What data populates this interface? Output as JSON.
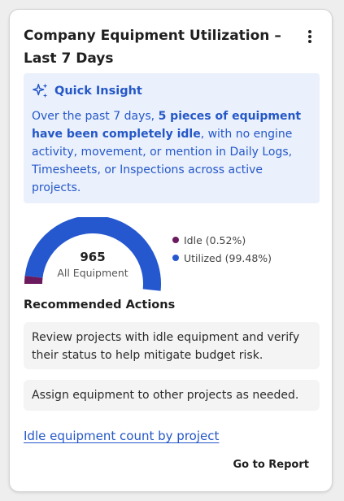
{
  "card": {
    "title": "Company Equipment Utilization – Last 7 Days",
    "menu_icon": "more-vertical-icon"
  },
  "insight": {
    "icon": "sparkles-icon",
    "title": "Quick Insight",
    "text_before": "Over the past 7 days, ",
    "text_bold": "5 pieces of equipment have been completely idle",
    "text_after": ", with no engine activity, movement, or mention in Daily Logs, Timesheets, or Inspections across active projects.",
    "accent_color": "#2557c7",
    "background_color": "#eaf1fd"
  },
  "chart_data": {
    "type": "pie",
    "variant": "semicircle-gauge",
    "total_value": "965",
    "total_label": "All Equipment",
    "series": [
      {
        "name": "Idle (0.52%)",
        "value": 0.52,
        "color": "#6b1a5e"
      },
      {
        "name": "Utilized (99.48%)",
        "value": 99.48,
        "color": "#2558cf"
      }
    ],
    "legend_position": "right"
  },
  "recommended": {
    "title": "Recommended Actions",
    "actions": [
      "Review projects with idle equipment and verify their status to help mitigate budget risk.",
      "Assign equipment to other projects as needed."
    ]
  },
  "link": {
    "label": "Idle equipment count by project"
  },
  "footer": {
    "go_to_report": "Go to Report"
  }
}
